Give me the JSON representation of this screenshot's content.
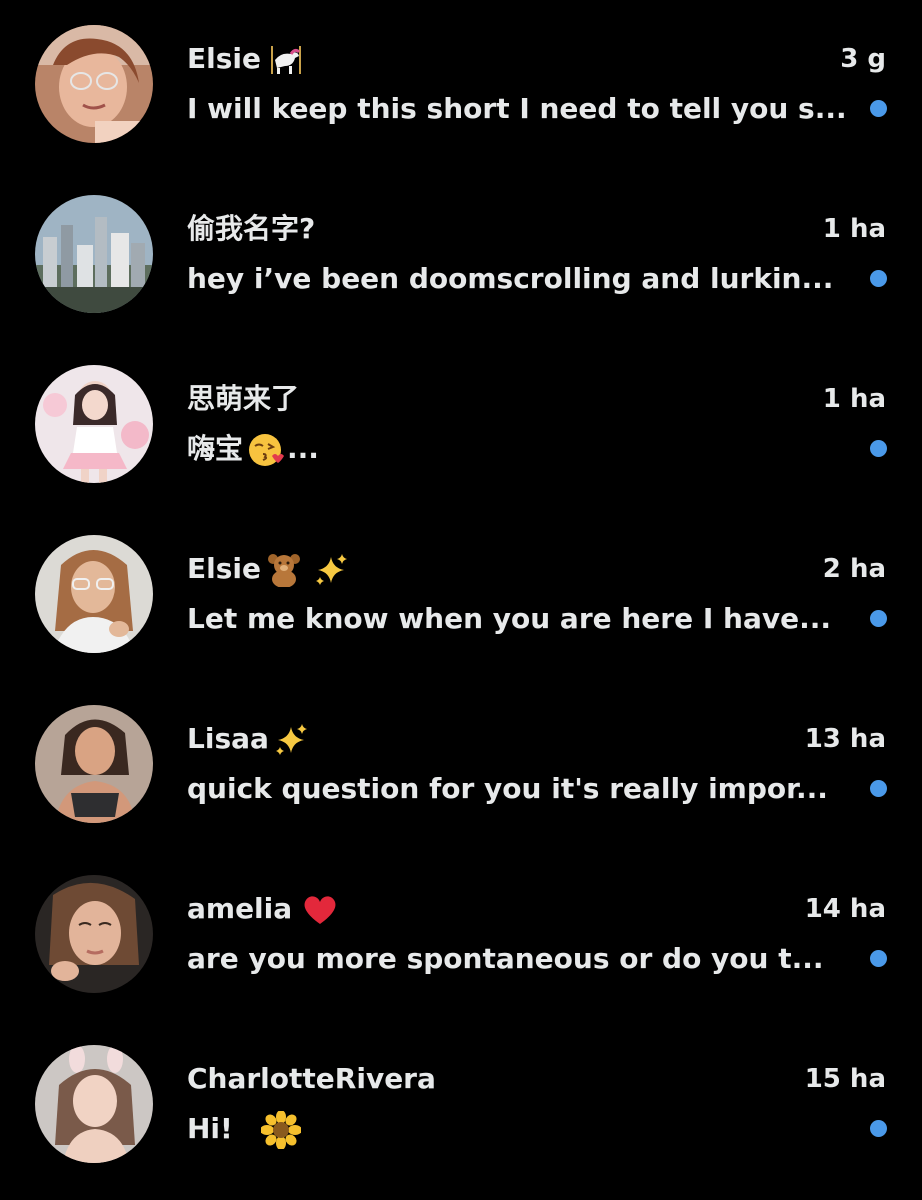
{
  "colors": {
    "background": "#000000",
    "text": "#e7e9ea",
    "unread_dot": "#4a99e9"
  },
  "conversations": [
    {
      "name": "Elsie",
      "name_emoji": [
        "carousel-horse-icon"
      ],
      "time": "3 g",
      "preview": "I will keep this short I need to tell you s...",
      "unread": true,
      "avatar": "avatar-elsie-glasses"
    },
    {
      "name": "偷我名字?",
      "name_emoji": [],
      "time": "1 ha",
      "preview": "hey i’ve been doomscrolling and lurkin...",
      "unread": true,
      "avatar": "avatar-city-skyline"
    },
    {
      "name": "思萌来了",
      "name_emoji": [],
      "time": "1 ha",
      "preview": "嗨宝",
      "preview_suffix": "...",
      "preview_emoji": [
        "kissing-face-icon"
      ],
      "unread": true,
      "avatar": "avatar-pink-outfit"
    },
    {
      "name": "Elsie",
      "name_emoji": [
        "teddy-bear-icon",
        "sparkles-icon"
      ],
      "time": "2 ha",
      "preview": "Let me know when you are here I have...",
      "unread": true,
      "avatar": "avatar-elsie-white-top"
    },
    {
      "name": "Lisaa",
      "name_emoji": [
        "sparkles-icon"
      ],
      "time": "13 ha",
      "preview": "quick question for you it's really impor...",
      "unread": true,
      "avatar": "avatar-lisaa"
    },
    {
      "name": "amelia",
      "name_emoji": [
        "red-heart-icon"
      ],
      "time": "14 ha",
      "preview": "are you more spontaneous or do you t...",
      "unread": true,
      "avatar": "avatar-amelia"
    },
    {
      "name": "CharlotteRivera",
      "name_emoji": [],
      "time": "15 ha",
      "preview": "Hi!",
      "preview_emoji": [
        "sunflower-icon"
      ],
      "unread": true,
      "avatar": "avatar-charlotte"
    }
  ]
}
